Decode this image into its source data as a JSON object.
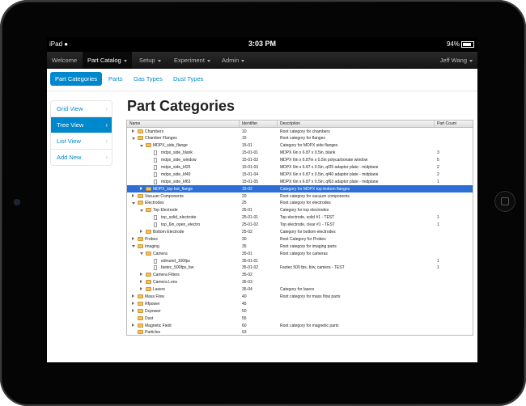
{
  "device": {
    "carrier": "iPad",
    "time": "3:03 PM",
    "battery": "94%"
  },
  "navbar": {
    "items": [
      {
        "label": "Welcome",
        "dropdown": false
      },
      {
        "label": "Part Catalog",
        "dropdown": true
      },
      {
        "label": "Setup",
        "dropdown": true
      },
      {
        "label": "Experiment",
        "dropdown": true
      },
      {
        "label": "Admin",
        "dropdown": true
      }
    ],
    "user": "Jeff Wang"
  },
  "subnav": {
    "items": [
      "Part Categories",
      "Parts",
      "Gas Types",
      "Dust Types"
    ]
  },
  "sidenav": {
    "items": [
      "Grid View",
      "Tree View",
      "List View",
      "Add New"
    ]
  },
  "page": {
    "title": "Part Categories"
  },
  "table": {
    "columns": [
      "Name",
      "Identifier",
      "Description",
      "Part Count"
    ],
    "rows": [
      {
        "level": 0,
        "toggle": "closed",
        "icon": "folder",
        "name": "Chambers",
        "id": "10",
        "desc": "Root category for chambers",
        "count": ""
      },
      {
        "level": 0,
        "toggle": "open",
        "icon": "folder",
        "name": "Chamber Flanges",
        "id": "15",
        "desc": "Root category for flanges",
        "count": ""
      },
      {
        "level": 1,
        "toggle": "open",
        "icon": "folder",
        "name": "MDPX_side_flange",
        "id": "15-01",
        "desc": "Category for MDPX side flanges",
        "count": ""
      },
      {
        "level": 2,
        "toggle": "",
        "icon": "doc",
        "name": "mdpx_side_blank",
        "id": "15-01-01",
        "desc": "MDPX 6in x 6.87 x 0.5in, blank",
        "count": "3"
      },
      {
        "level": 2,
        "toggle": "",
        "icon": "doc",
        "name": "mdpx_side_window",
        "id": "15-01-02",
        "desc": "MDPX 6in x 6.87in x 0.5in polycarbonate window",
        "count": "5"
      },
      {
        "level": 2,
        "toggle": "",
        "icon": "doc",
        "name": "mdpx_side_kf25",
        "id": "15-01-03",
        "desc": "MDPX 6in x 6.87 x 0.5in, qf25 adaptor plate - midplane",
        "count": "2"
      },
      {
        "level": 2,
        "toggle": "",
        "icon": "doc",
        "name": "mdpx_side_kf40",
        "id": "15-01-04",
        "desc": "MDPX 6in x 6.87 x 0.5in, qf40 adaptor plate - midplane",
        "count": "2"
      },
      {
        "level": 2,
        "toggle": "",
        "icon": "doc",
        "name": "mdpx_side_kf63",
        "id": "15-01-05",
        "desc": "MDPX 6in x 6.87 x 0.5in, qf63 adaptor plate - midplane",
        "count": "1"
      },
      {
        "level": 1,
        "toggle": "closed",
        "icon": "folder",
        "name": "MDPX_top-bot_flange",
        "id": "15-02",
        "desc": "Category for MDPX top-bottom flanges",
        "count": "",
        "selected": true
      },
      {
        "level": 0,
        "toggle": "closed",
        "icon": "folder",
        "name": "Vacuum Components",
        "id": "20",
        "desc": "Root category for vacuum components",
        "count": ""
      },
      {
        "level": 0,
        "toggle": "open",
        "icon": "folder",
        "name": "Electrodes",
        "id": "25",
        "desc": "Root category for electrodes",
        "count": ""
      },
      {
        "level": 1,
        "toggle": "open",
        "icon": "folder",
        "name": "Top Electrode",
        "id": "25-01",
        "desc": "Category for top electrodes",
        "count": ""
      },
      {
        "level": 2,
        "toggle": "",
        "icon": "doc",
        "name": "top_solid_electrode",
        "id": "25-01-01",
        "desc": "Top electrode, solid #1 - TEST",
        "count": "1"
      },
      {
        "level": 2,
        "toggle": "",
        "icon": "doc",
        "name": "top_6in_open_electro",
        "id": "25-01-02",
        "desc": "Top electrode, clear #1 - TEST",
        "count": "1"
      },
      {
        "level": 1,
        "toggle": "closed",
        "icon": "folder",
        "name": "Bottom Electrode",
        "id": "25-02",
        "desc": "Category for bottom electrodes",
        "count": ""
      },
      {
        "level": 0,
        "toggle": "closed",
        "icon": "folder",
        "name": "Probes",
        "id": "30",
        "desc": "Root Category for Probes",
        "count": ""
      },
      {
        "level": 0,
        "toggle": "open",
        "icon": "folder",
        "name": "Imaging",
        "id": "35",
        "desc": "Root category for imaging parts",
        "count": ""
      },
      {
        "level": 1,
        "toggle": "open",
        "icon": "folder",
        "name": "Camera",
        "id": "35-01",
        "desc": "Root category for cameras",
        "count": ""
      },
      {
        "level": 2,
        "toggle": "",
        "icon": "doc",
        "name": "edmund_100fps",
        "id": "35-01-01",
        "desc": "",
        "count": "1"
      },
      {
        "level": 2,
        "toggle": "",
        "icon": "doc",
        "name": "fastec_500fps_bw",
        "id": "35-01-02",
        "desc": "Fastec 500 fps, b/w, camera - TEST",
        "count": "1"
      },
      {
        "level": 1,
        "toggle": "closed",
        "icon": "folder",
        "name": "Camera Filters",
        "id": "35-02",
        "desc": "",
        "count": ""
      },
      {
        "level": 1,
        "toggle": "closed",
        "icon": "folder",
        "name": "Camera Lens",
        "id": "35-03",
        "desc": "",
        "count": ""
      },
      {
        "level": 1,
        "toggle": "closed",
        "icon": "folder",
        "name": "Lasers",
        "id": "35-04",
        "desc": "Category for lasers",
        "count": ""
      },
      {
        "level": 0,
        "toggle": "closed",
        "icon": "folder",
        "name": "Mass Flow",
        "id": "40",
        "desc": "Root category for mass flow parts",
        "count": ""
      },
      {
        "level": 0,
        "toggle": "closed",
        "icon": "folder",
        "name": "Rfpower",
        "id": "45",
        "desc": "",
        "count": ""
      },
      {
        "level": 0,
        "toggle": "closed",
        "icon": "folder",
        "name": "Dcpower",
        "id": "50",
        "desc": "",
        "count": ""
      },
      {
        "level": 0,
        "toggle": "",
        "icon": "folder",
        "name": "Dust",
        "id": "55",
        "desc": "",
        "count": ""
      },
      {
        "level": 0,
        "toggle": "closed",
        "icon": "folder",
        "name": "Magnetic Field",
        "id": "60",
        "desc": "Root category for magnetic parts",
        "count": ""
      },
      {
        "level": 0,
        "toggle": "",
        "icon": "folder",
        "name": "Particles",
        "id": "63",
        "desc": "",
        "count": ""
      }
    ]
  },
  "colors": {
    "accent": "#0088cc",
    "selection": "#2e6fd6",
    "navbar": "#1b1b1b",
    "folder": "#f3c15f"
  }
}
